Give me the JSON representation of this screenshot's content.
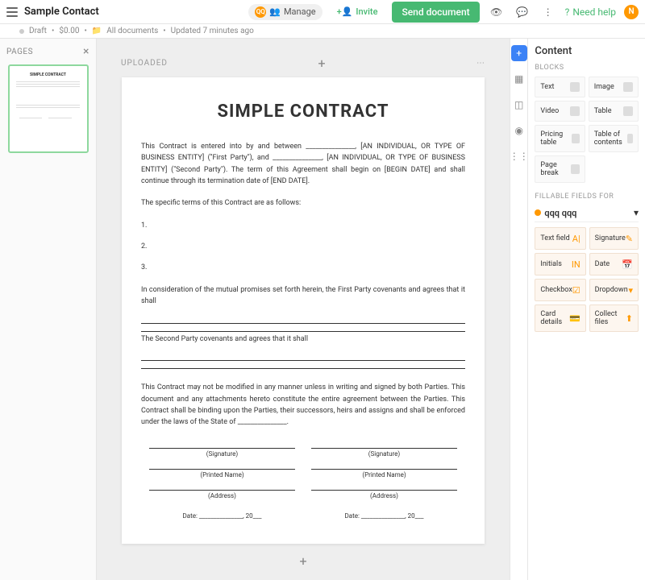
{
  "header": {
    "title": "Sample Contact",
    "status": "Draft",
    "price": "$0.00",
    "location": "All documents",
    "updated": "Updated 7 minutes ago",
    "manage": "Manage",
    "invite": "Invite",
    "send": "Send document",
    "help": "Need help",
    "avatar": "N",
    "qq": "QQ"
  },
  "pages": {
    "label": "PAGES"
  },
  "canvas": {
    "uploaded": "UPLOADED"
  },
  "doc": {
    "title": "SIMPLE CONTRACT",
    "intro": "This Contract is entered into by and between _______________, [AN INDIVIDUAL, OR TYPE OF BUSINESS ENTITY] (\"First Party\"), and _______________, [AN INDIVIDUAL, OR TYPE OF BUSINESS ENTITY] (\"Second Party\").   The term of this Agreement shall begin on [BEGIN DATE] and shall continue through its termination date of [END DATE].",
    "terms": "The specific terms of this Contract are as follows:",
    "n1": "1.",
    "n2": "2.",
    "n3": "3.",
    "consideration": "In consideration of the mutual promises set forth herein, the First Party covenants and agrees that it shall",
    "second": "The Second Party covenants and agrees that it shall",
    "closing": "This Contract may not be modified in any manner unless in writing and signed by both Parties. This document and any attachments hereto constitute the entire agreement between the Parties.  This Contract shall be binding upon the Parties, their successors, heirs and assigns and shall be enforced under the laws of the State of _______________.",
    "sig": "(Signature)",
    "pname": "(Printed Name)",
    "addr": "(Address)",
    "date": "Date: _______________, 20___"
  },
  "content": {
    "title": "Content",
    "blocks_label": "BLOCKS",
    "blocks": [
      "Text",
      "Image",
      "Video",
      "Table",
      "Pricing table",
      "Table of contents",
      "Page break"
    ],
    "fillable_label": "FILLABLE FIELDS FOR",
    "user": "qqq qqq",
    "fields": [
      "Text field",
      "Signature",
      "Initials",
      "Date",
      "Checkbox",
      "Dropdown",
      "Card details",
      "Collect files"
    ]
  }
}
